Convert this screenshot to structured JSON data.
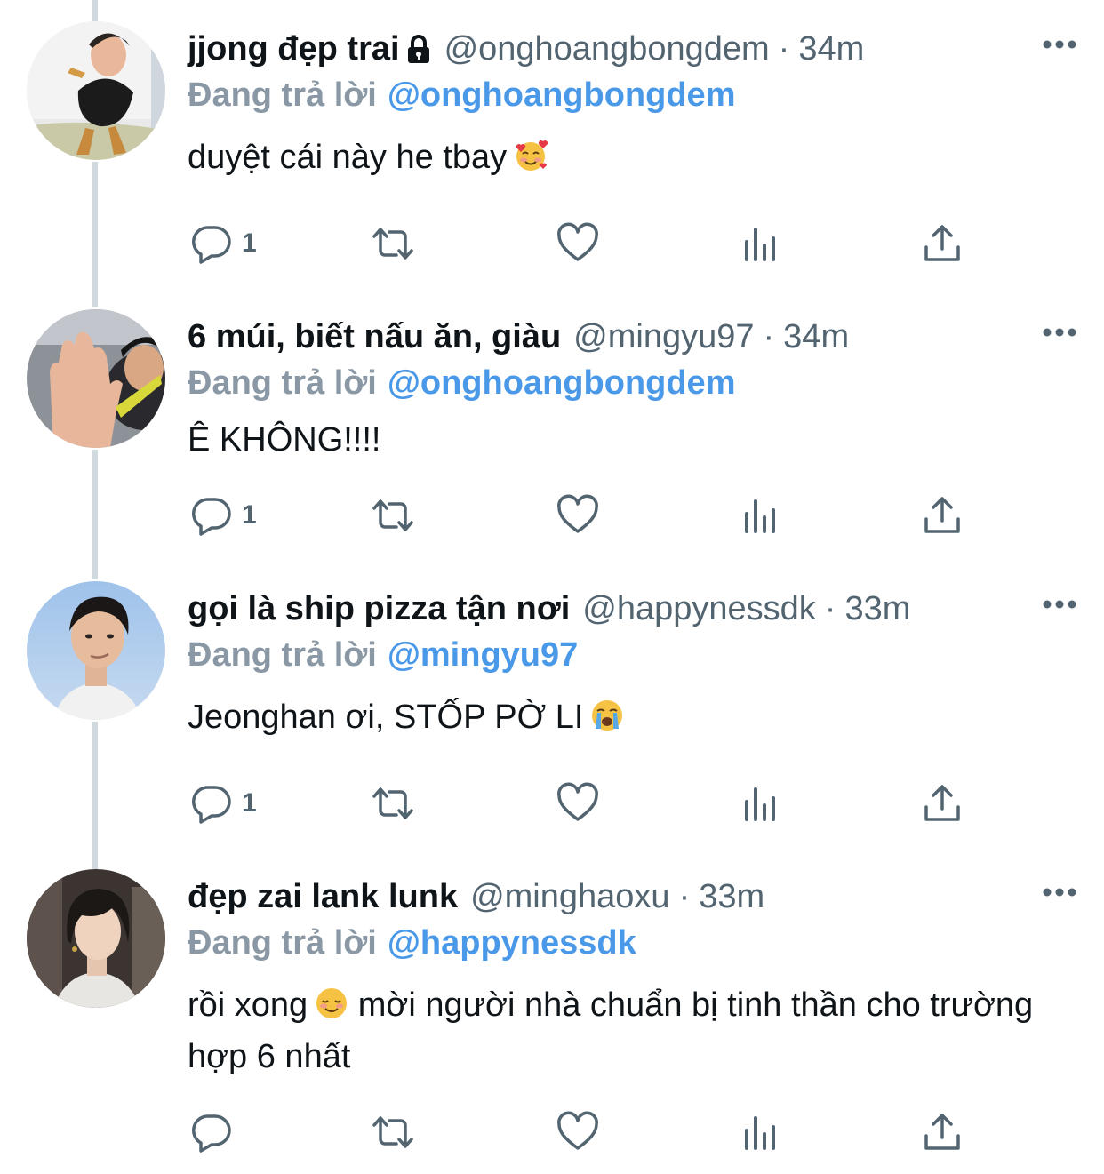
{
  "tweets": [
    {
      "display_name": "jjong đẹp trai",
      "locked": true,
      "handle": "@onghoangbongdem",
      "separator": "·",
      "time": "34m",
      "reply_prefix": "Đang trả lời",
      "reply_to": "@onghoangbongdem",
      "text": "duyệt cái này he tbay",
      "emoji": "smiling-face-with-hearts",
      "reply_count": "1"
    },
    {
      "display_name": "6 múi, biết nấu ăn, giàu",
      "locked": false,
      "handle": "@mingyu97",
      "separator": "·",
      "time": "34m",
      "reply_prefix": "Đang trả lời",
      "reply_to": "@onghoangbongdem",
      "text": "Ê KHÔNG!!!!",
      "emoji": "",
      "reply_count": "1"
    },
    {
      "display_name": "gọi là ship pizza tận nơi",
      "locked": false,
      "handle": "@happynessdk",
      "separator": "·",
      "time": "33m",
      "reply_prefix": "Đang trả lời",
      "reply_to": "@mingyu97",
      "text": "Jeonghan ơi, STỐP PỜ LI",
      "emoji": "loudly-crying-face",
      "reply_count": "1"
    },
    {
      "display_name": "đẹp zai lank lunk",
      "locked": false,
      "handle": "@minghaoxu",
      "separator": "·",
      "time": "33m",
      "reply_prefix": "Đang trả lời",
      "reply_to": "@happynessdk",
      "text_part1": "rồi xong",
      "emoji": "smiling-face",
      "text_part2": " mời người nhà chuẩn bị tinh thần cho trường hợp 6 nhất",
      "reply_count": ""
    }
  ],
  "icons": [
    "reply-icon",
    "retweet-icon",
    "like-icon",
    "analytics-icon",
    "share-icon",
    "more-icon",
    "lock-icon"
  ],
  "colors": {
    "text": "#0f1419",
    "secondary": "#536471",
    "link": "#4a99e9",
    "thread_line": "#cfd9de"
  }
}
